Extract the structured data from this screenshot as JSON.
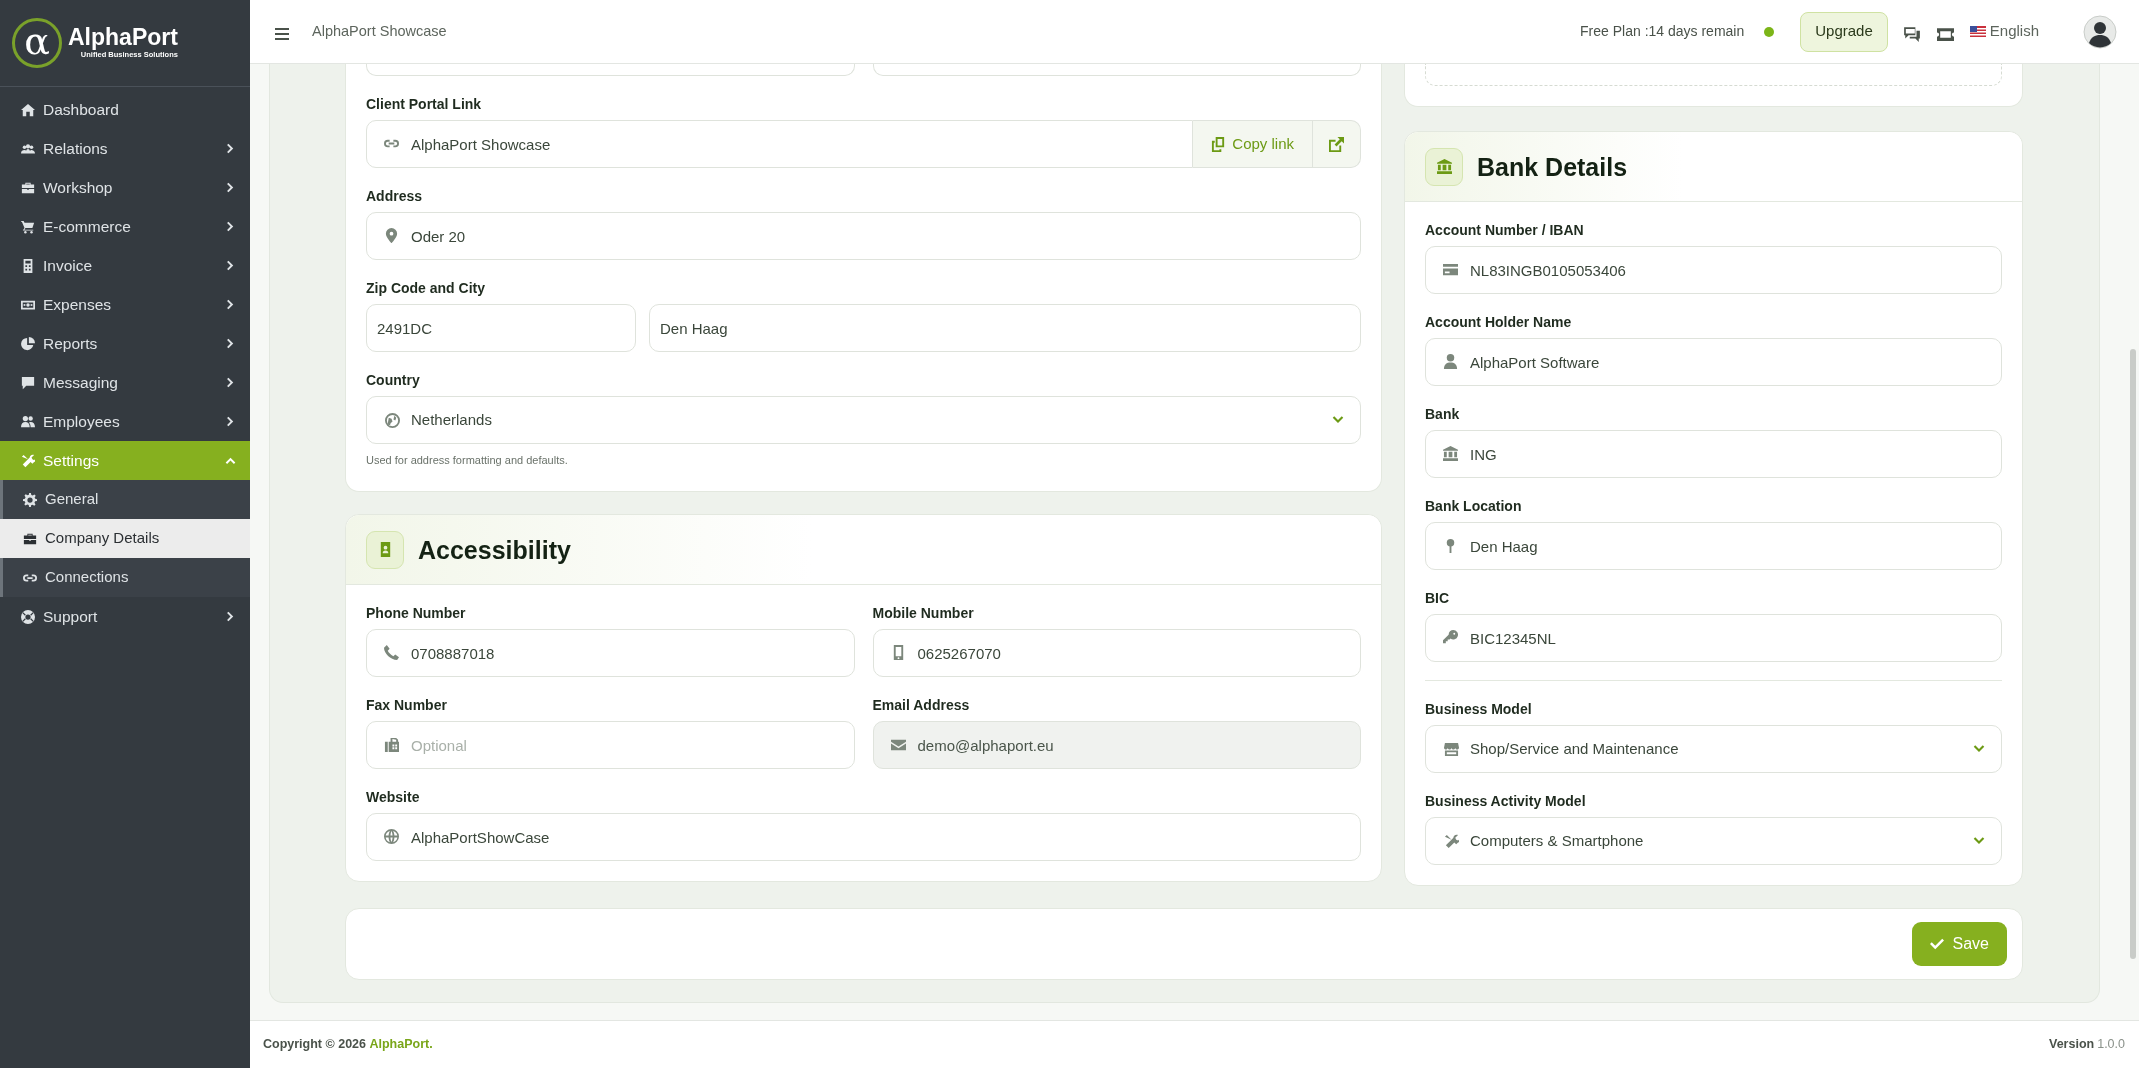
{
  "sidebar": {
    "logo": {
      "mark": "α",
      "name": "AlphaPort",
      "tagline": "Unified Business Solutions"
    },
    "items": [
      {
        "label": "Dashboard",
        "kind": "link",
        "selected": false
      },
      {
        "label": "Relations",
        "kind": "menu",
        "expanded": false,
        "selected": false
      },
      {
        "label": "Workshop",
        "kind": "menu",
        "expanded": false,
        "selected": false
      },
      {
        "label": "E-commerce",
        "kind": "menu",
        "expanded": false,
        "selected": false
      },
      {
        "label": "Invoice",
        "kind": "menu",
        "expanded": false,
        "selected": false
      },
      {
        "label": "Expenses",
        "kind": "menu",
        "expanded": false,
        "selected": false
      },
      {
        "label": "Reports",
        "kind": "menu",
        "expanded": false,
        "selected": false
      },
      {
        "label": "Messaging",
        "kind": "menu",
        "expanded": false,
        "selected": false
      },
      {
        "label": "Employees",
        "kind": "menu",
        "expanded": false,
        "selected": false
      },
      {
        "label": "Settings",
        "kind": "menu",
        "expanded": true,
        "selected": true,
        "children": [
          {
            "label": "General",
            "selected": false
          },
          {
            "label": "Company Details",
            "selected": true
          },
          {
            "label": "Connections",
            "selected": false
          }
        ]
      },
      {
        "label": "Support",
        "kind": "menu",
        "expanded": false,
        "selected": false
      }
    ]
  },
  "topbar": {
    "title": "AlphaPort Showcase",
    "plan": "Free Plan :14 days remain",
    "upgrade": "Upgrade",
    "language": "English"
  },
  "company": {
    "client_portal": {
      "label": "Client Portal Link",
      "value": "AlphaPort Showcase",
      "copy": "Copy link"
    },
    "address": {
      "label": "Address",
      "value": "Oder 20"
    },
    "zip_city": {
      "label": "Zip Code and City",
      "zip": "2491DC",
      "city": "Den Haag"
    },
    "country": {
      "label": "Country",
      "value": "Netherlands",
      "help": "Used for address formatting and defaults."
    }
  },
  "accessibility": {
    "title": "Accessibility",
    "fields": [
      {
        "label": "Phone Number",
        "value": "0708887018",
        "disabled": false
      },
      {
        "label": "Mobile Number",
        "value": "0625267070",
        "disabled": false
      },
      {
        "label": "Fax Number",
        "placeholder": "Optional",
        "disabled": false
      },
      {
        "label": "Email Address",
        "value": "demo@alphaport.eu",
        "disabled": true
      },
      {
        "label": "Website",
        "value": "AlphaPortShowCase",
        "disabled": false
      }
    ]
  },
  "bank": {
    "title": "Bank Details",
    "fields": [
      {
        "label": "Account Number / IBAN",
        "value": "NL83INGB0105053406"
      },
      {
        "label": "Account Holder Name",
        "value": "AlphaPort Software"
      },
      {
        "label": "Bank",
        "value": "ING"
      },
      {
        "label": "Bank Location",
        "value": "Den Haag"
      },
      {
        "label": "BIC",
        "value": "BIC12345NL"
      }
    ],
    "selects": [
      {
        "label": "Business Model",
        "value": "Shop/Service and Maintenance"
      },
      {
        "label": "Business Activity Model",
        "value": "Computers & Smartphone"
      }
    ]
  },
  "save": "Save",
  "footer": {
    "copyright": "Copyright © 2026",
    "brand": "AlphaPort.",
    "version_label": "Version",
    "version": "1.0.0"
  }
}
